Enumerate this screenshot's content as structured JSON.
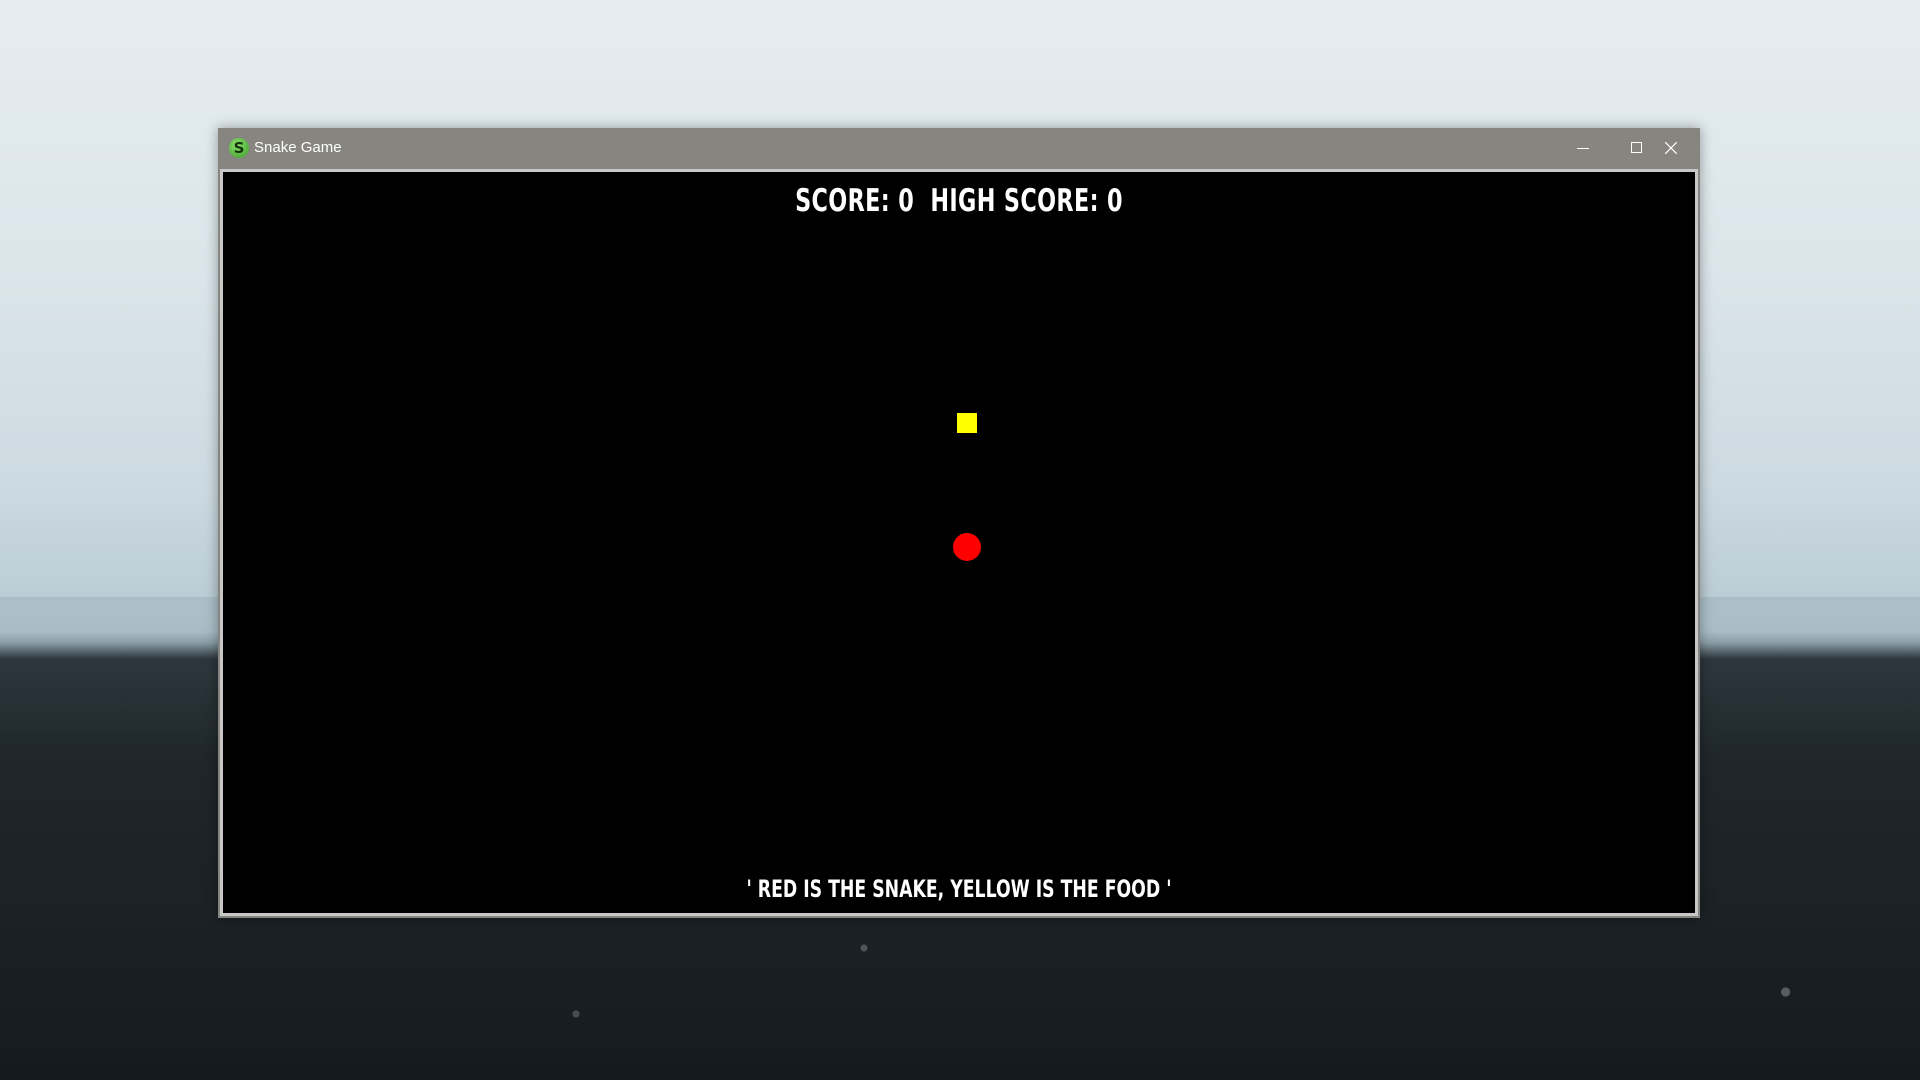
{
  "window": {
    "title": "Snake Game",
    "app_icon": "snake-app-icon",
    "controls": {
      "minimize_icon": "minimize-icon",
      "maximize_icon": "maximize-icon",
      "close_icon": "close-icon"
    }
  },
  "game": {
    "score_label": "SCORE: 0",
    "high_score_label": "HIGH SCORE: 0",
    "hint": "' RED IS THE SNAKE, YELLOW IS THE FOOD '",
    "colors": {
      "background": "#000000",
      "snake": "#ff0000",
      "food": "#ffff00",
      "text": "#ffffff"
    }
  }
}
